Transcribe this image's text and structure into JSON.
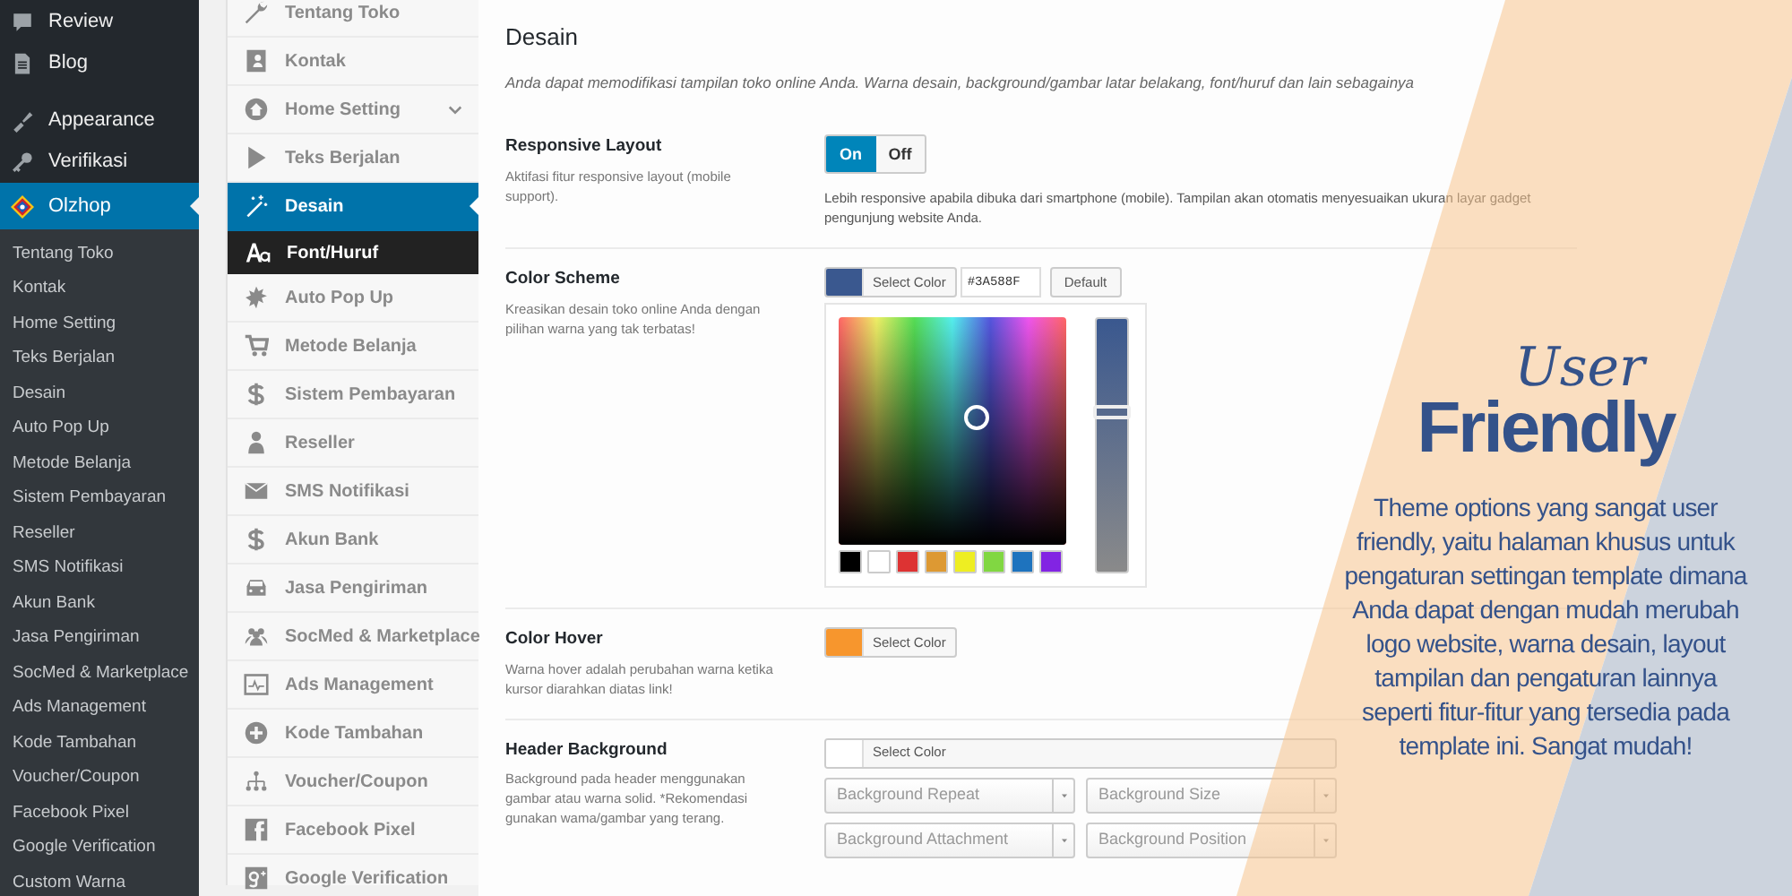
{
  "admin_menu": {
    "items": [
      {
        "label": "Review",
        "selected": false
      },
      {
        "label": "Blog",
        "selected": false
      },
      {
        "label": "Appearance",
        "selected": false
      },
      {
        "label": "Verifikasi",
        "selected": false
      },
      {
        "label": "Olzhop",
        "selected": true
      }
    ],
    "submenu": [
      {
        "label": "Tentang Toko",
        "selected": false
      },
      {
        "label": "Kontak",
        "selected": false
      },
      {
        "label": "Home Setting",
        "selected": false
      },
      {
        "label": "Teks Berjalan",
        "selected": false
      },
      {
        "label": "Desain",
        "selected": false
      },
      {
        "label": "Auto Pop Up",
        "selected": false
      },
      {
        "label": "Metode Belanja",
        "selected": false
      },
      {
        "label": "Sistem Pembayaran",
        "selected": false
      },
      {
        "label": "Reseller",
        "selected": false
      },
      {
        "label": "SMS Notifikasi",
        "selected": false
      },
      {
        "label": "Akun Bank",
        "selected": false
      },
      {
        "label": "Jasa Pengiriman",
        "selected": false
      },
      {
        "label": "SocMed & Marketplace",
        "selected": false
      },
      {
        "label": "Ads Management",
        "selected": false
      },
      {
        "label": "Kode Tambahan",
        "selected": false
      },
      {
        "label": "Voucher/Coupon",
        "selected": false
      },
      {
        "label": "Facebook Pixel",
        "selected": false
      },
      {
        "label": "Google Verification",
        "selected": false
      },
      {
        "label": "Custom Warna",
        "selected": false
      }
    ]
  },
  "options_menu": [
    {
      "label": "Tentang Toko",
      "selected": false
    },
    {
      "label": "Kontak",
      "selected": false
    },
    {
      "label": "Home Setting",
      "selected": false,
      "expanded": false
    },
    {
      "label": "Teks Berjalan",
      "selected": false
    },
    {
      "label": "Desain",
      "selected": true,
      "children": [
        {
          "label": "Font/Huruf"
        }
      ]
    },
    {
      "label": "Auto Pop Up",
      "selected": false
    },
    {
      "label": "Metode Belanja",
      "selected": false
    },
    {
      "label": "Sistem Pembayaran",
      "selected": false
    },
    {
      "label": "Reseller",
      "selected": false
    },
    {
      "label": "SMS Notifikasi",
      "selected": false
    },
    {
      "label": "Akun Bank",
      "selected": false
    },
    {
      "label": "Jasa Pengiriman",
      "selected": false
    },
    {
      "label": "SocMed & Marketplace",
      "selected": false
    },
    {
      "label": "Ads Management",
      "selected": false
    },
    {
      "label": "Kode Tambahan",
      "selected": false
    },
    {
      "label": "Voucher/Coupon",
      "selected": false
    },
    {
      "label": "Facebook Pixel",
      "selected": false
    },
    {
      "label": "Google Verification",
      "selected": false
    }
  ],
  "content": {
    "title": "Desain",
    "intro": "Anda dapat memodifikasi tampilan toko online Anda. Warna desain, background/gambar latar belakang, font/huruf dan lain sebagainya",
    "settings": [
      {
        "kind": "toggle",
        "label": "Responsive Layout",
        "description": "Aktifasi fitur responsive layout (mobile support).",
        "on": true,
        "on_label": "On",
        "off_label": "Off",
        "note": "Lebih responsive apabila dibuka dari smartphone (mobile). Tampilan akan otomatis menyesuaikan ukuran layar gadget pengunjung website Anda."
      },
      {
        "kind": "color_picker",
        "label": "Color Scheme",
        "description": "Kreasikan desain toko online Anda dengan pilihan warna yang tak terbatas!",
        "color": "#3a588f",
        "button": "Select Color",
        "value": "#3A588F",
        "default_button": "Default",
        "level": 0.63,
        "palette": [
          {
            "color": "#000000"
          },
          {
            "color": "#ffffff"
          },
          {
            "color": "#dd3333"
          },
          {
            "color": "#dd9933"
          },
          {
            "color": "#eeee22"
          },
          {
            "color": "#81d742"
          },
          {
            "color": "#1e73be"
          },
          {
            "color": "#8224e3"
          }
        ]
      },
      {
        "kind": "color",
        "label": "Color Hover",
        "description": "Warna hover adalah perubahan warna ketika kursor diarahkan diatas link!",
        "color": "#f7962d",
        "button": "Select Color"
      },
      {
        "kind": "background",
        "label": "Header Background",
        "description": "Background pada header menggunakan gambar atau warna solid. *Rekomendasi gunakan wama/gambar yang terang.",
        "color": "#ffffff",
        "button": "Select Color",
        "selects": [
          {
            "placeholder": "Background Repeat"
          },
          {
            "placeholder": "Background Size"
          },
          {
            "placeholder": "Background Attachment"
          },
          {
            "placeholder": "Background Position"
          }
        ]
      }
    ]
  },
  "promo": {
    "script_title": "User",
    "title": "Friendly",
    "body": "Theme options yang sangat user friendly, yaitu halaman khusus untuk pengaturan settingan template dimana Anda dapat dengan mudah merubah logo website, warna desain, layout tampilan dan pengaturan lainnya seperti fitur-fitur yang tersedia pada template ini. Sangat mudah!"
  }
}
